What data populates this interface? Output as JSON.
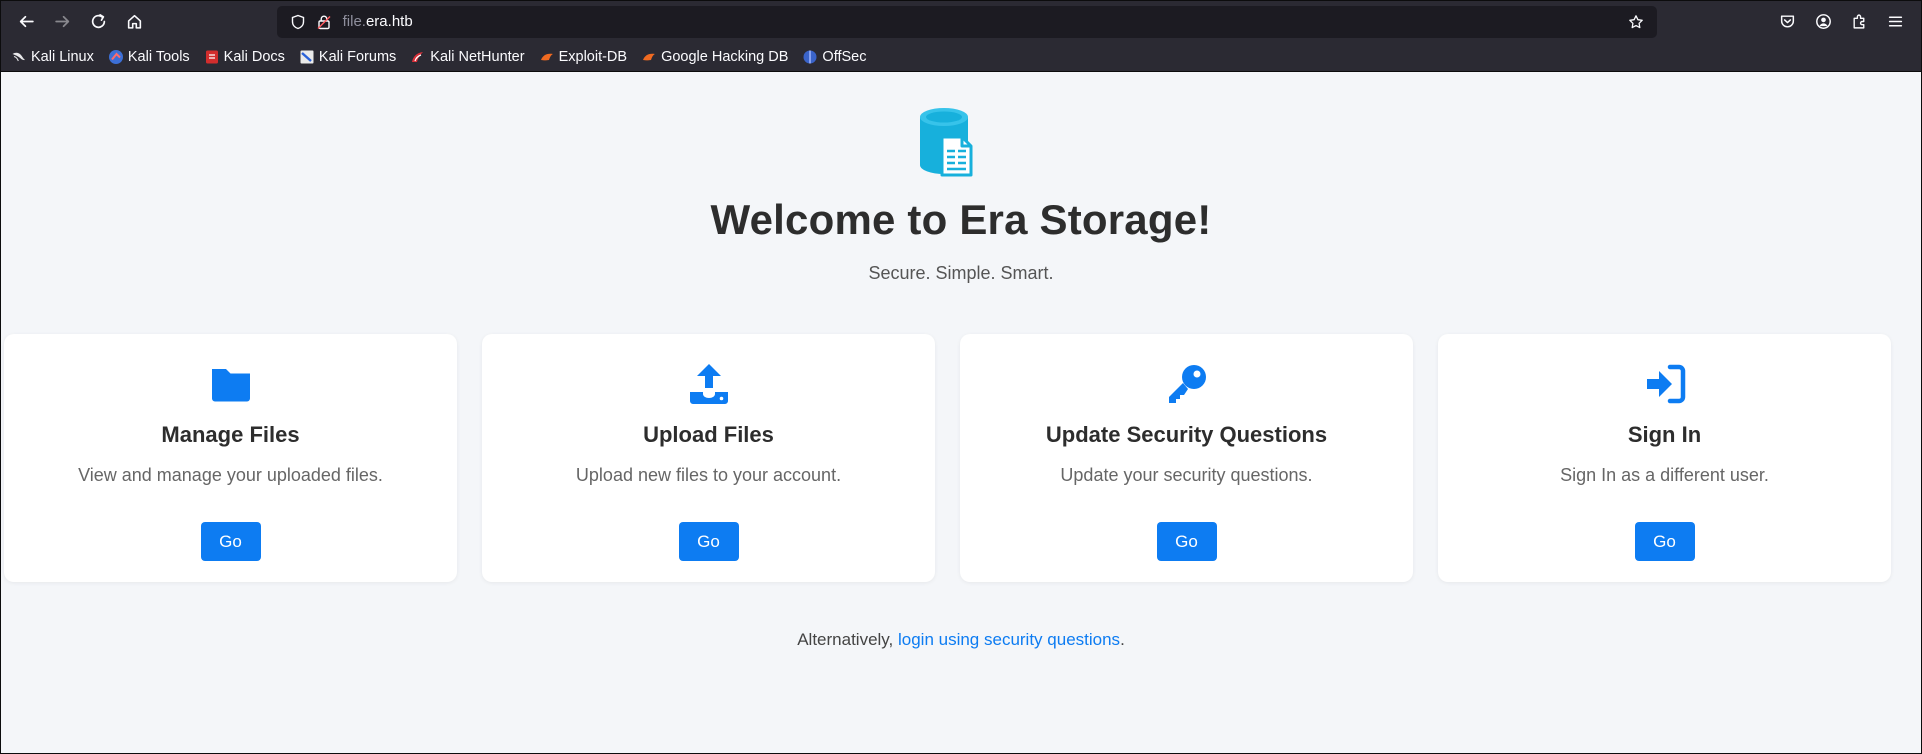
{
  "browser": {
    "url": {
      "subdomain": "file.",
      "domain": "era.htb"
    },
    "bookmarks": [
      {
        "label": "Kali Linux",
        "icon": "kali-dragon-icon"
      },
      {
        "label": "Kali Tools",
        "icon": "kali-tools-icon"
      },
      {
        "label": "Kali Docs",
        "icon": "kali-docs-icon"
      },
      {
        "label": "Kali Forums",
        "icon": "kali-forums-icon"
      },
      {
        "label": "Kali NetHunter",
        "icon": "kali-nethunter-icon"
      },
      {
        "label": "Exploit-DB",
        "icon": "exploit-db-icon"
      },
      {
        "label": "Google Hacking DB",
        "icon": "ghdb-icon"
      },
      {
        "label": "OffSec",
        "icon": "offsec-icon"
      }
    ]
  },
  "page": {
    "title": "Welcome to Era Storage!",
    "tagline": "Secure. Simple. Smart.",
    "accent_color": "#0d7cf2",
    "hero_icon": "database-file-icon",
    "cards": [
      {
        "title": "Manage Files",
        "description": "View and manage your uploaded files.",
        "button": "Go",
        "icon": "folder-icon"
      },
      {
        "title": "Upload Files",
        "description": "Upload new files to your account.",
        "button": "Go",
        "icon": "upload-icon"
      },
      {
        "title": "Update Security Questions",
        "description": "Update your security questions.",
        "button": "Go",
        "icon": "key-icon"
      },
      {
        "title": "Sign In",
        "description": "Sign In as a different user.",
        "button": "Go",
        "icon": "sign-in-icon"
      }
    ],
    "footer": {
      "prefix": "Alternatively, ",
      "link": "login using security questions",
      "suffix": "."
    }
  }
}
